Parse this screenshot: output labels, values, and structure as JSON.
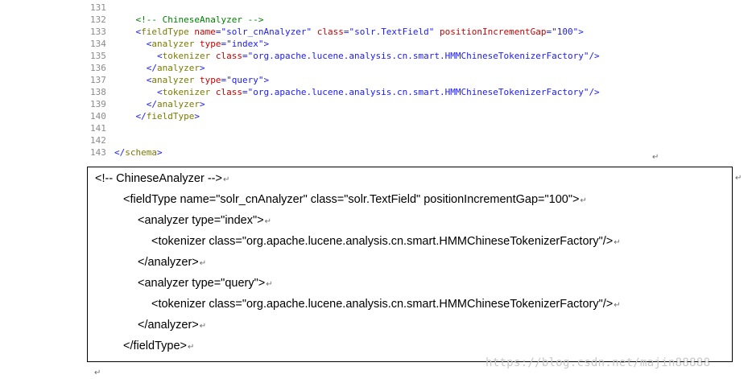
{
  "code_editor": {
    "lines": [
      {
        "num": "131",
        "indent": "",
        "segments": []
      },
      {
        "num": "132",
        "indent": "    ",
        "segments": [
          {
            "cls": "c-comment",
            "text": "<!-- ChineseAnalyzer -->"
          }
        ]
      },
      {
        "num": "133",
        "indent": "    ",
        "segments": [
          {
            "cls": "c-punct",
            "text": "<"
          },
          {
            "cls": "c-tag",
            "text": "fieldType"
          },
          {
            "cls": "c-attr",
            "text": " name"
          },
          {
            "cls": "c-punct",
            "text": "="
          },
          {
            "cls": "c-value",
            "text": "\"solr_cnAnalyzer\""
          },
          {
            "cls": "c-attr",
            "text": " class"
          },
          {
            "cls": "c-punct",
            "text": "="
          },
          {
            "cls": "c-value",
            "text": "\"solr.TextField\""
          },
          {
            "cls": "c-attr",
            "text": " positionIncrementGap"
          },
          {
            "cls": "c-punct",
            "text": "="
          },
          {
            "cls": "c-value",
            "text": "\"100\""
          },
          {
            "cls": "c-punct",
            "text": ">"
          }
        ]
      },
      {
        "num": "134",
        "indent": "      ",
        "segments": [
          {
            "cls": "c-punct",
            "text": "<"
          },
          {
            "cls": "c-tag",
            "text": "analyzer"
          },
          {
            "cls": "c-attr",
            "text": " type"
          },
          {
            "cls": "c-punct",
            "text": "="
          },
          {
            "cls": "c-value",
            "text": "\"index\""
          },
          {
            "cls": "c-punct",
            "text": ">"
          }
        ]
      },
      {
        "num": "135",
        "indent": "        ",
        "segments": [
          {
            "cls": "c-punct",
            "text": "<"
          },
          {
            "cls": "c-tag",
            "text": "tokenizer"
          },
          {
            "cls": "c-attr",
            "text": " class"
          },
          {
            "cls": "c-punct",
            "text": "="
          },
          {
            "cls": "c-value",
            "text": "\"org.apache.lucene.analysis.cn.smart.HMMChineseTokenizerFactory\""
          },
          {
            "cls": "c-punct",
            "text": "/>"
          }
        ]
      },
      {
        "num": "136",
        "indent": "      ",
        "segments": [
          {
            "cls": "c-punct",
            "text": "</"
          },
          {
            "cls": "c-tag",
            "text": "analyzer"
          },
          {
            "cls": "c-punct",
            "text": ">"
          }
        ]
      },
      {
        "num": "137",
        "indent": "      ",
        "segments": [
          {
            "cls": "c-punct",
            "text": "<"
          },
          {
            "cls": "c-tag",
            "text": "analyzer"
          },
          {
            "cls": "c-attr",
            "text": " type"
          },
          {
            "cls": "c-punct",
            "text": "="
          },
          {
            "cls": "c-value",
            "text": "\"query\""
          },
          {
            "cls": "c-punct",
            "text": ">"
          }
        ]
      },
      {
        "num": "138",
        "indent": "        ",
        "segments": [
          {
            "cls": "c-punct",
            "text": "<"
          },
          {
            "cls": "c-tag",
            "text": "tokenizer"
          },
          {
            "cls": "c-attr",
            "text": " class"
          },
          {
            "cls": "c-punct",
            "text": "="
          },
          {
            "cls": "c-value",
            "text": "\"org.apache.lucene.analysis.cn.smart.HMMChineseTokenizerFactory\""
          },
          {
            "cls": "c-punct",
            "text": "/>"
          }
        ]
      },
      {
        "num": "139",
        "indent": "      ",
        "segments": [
          {
            "cls": "c-punct",
            "text": "</"
          },
          {
            "cls": "c-tag",
            "text": "analyzer"
          },
          {
            "cls": "c-punct",
            "text": ">"
          }
        ]
      },
      {
        "num": "140",
        "indent": "    ",
        "segments": [
          {
            "cls": "c-punct",
            "text": "</"
          },
          {
            "cls": "c-tag",
            "text": "fieldType"
          },
          {
            "cls": "c-punct",
            "text": ">"
          }
        ]
      },
      {
        "num": "141",
        "indent": "",
        "segments": []
      },
      {
        "num": "142",
        "indent": "",
        "segments": []
      },
      {
        "num": "143",
        "indent": "",
        "segments": [
          {
            "cls": "c-punct",
            "text": "</"
          },
          {
            "cls": "c-tag",
            "text": "schema"
          },
          {
            "cls": "c-punct",
            "text": ">"
          }
        ]
      }
    ]
  },
  "paragraph_mark_symbol": "↵",
  "text_box": {
    "lines": [
      "<!-- ChineseAnalyzer -->",
      "<fieldType name=\"solr_cnAnalyzer\" class=\"solr.TextField\" positionIncrementGap=\"100\">",
      "<analyzer type=\"index\">",
      "<tokenizer class=\"org.apache.lucene.analysis.cn.smart.HMMChineseTokenizerFactory\"/>",
      "</analyzer>",
      "<analyzer type=\"query\">",
      "<tokenizer class=\"org.apache.lucene.analysis.cn.smart.HMMChineseTokenizerFactory\"/>",
      "</analyzer>",
      "</fieldType>"
    ]
  },
  "watermark": "https://blog.csdn.net/majin88888",
  "colors": {
    "comment": "#008000",
    "tag": "#7a7a00",
    "attribute": "#cc0000",
    "value": "#1a1aff",
    "line_number": "#8a8a8a"
  }
}
